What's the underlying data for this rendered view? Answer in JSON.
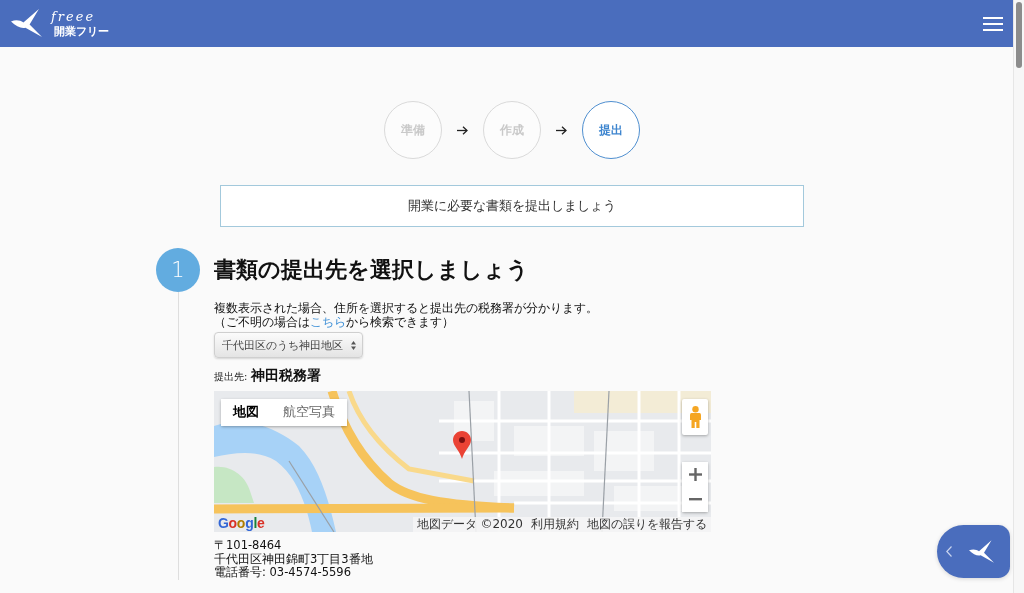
{
  "header": {
    "logo_script": "freee",
    "logo_title": "開業フリー"
  },
  "steps": [
    {
      "label": "準備",
      "selected": false
    },
    {
      "label": "作成",
      "selected": false
    },
    {
      "label": "提出",
      "selected": true
    }
  ],
  "banner": "開業に必要な書類を提出しましょう",
  "section": {
    "number": "1",
    "title": "書類の提出先を選択しましょう",
    "description": {
      "line_1": "複数表示された場合、住所を選択すると提出先の税務署が分かります。",
      "before_link": "（ご不明の場合は",
      "link": "こちら",
      "after_link": "から検索できます）"
    },
    "district_select": {
      "value": "千代田区のうち神田地区"
    },
    "office": {
      "label": "提出先:",
      "name": "神田税務署"
    },
    "map": {
      "map_types": [
        {
          "label": "地図",
          "selected": true
        },
        {
          "label": "航空写真",
          "selected": false
        }
      ],
      "logo": "Google",
      "data_credit": "地図データ ©2020",
      "terms_link": "利用規約",
      "report_link": "地図の誤りを報告する"
    },
    "address": {
      "postal_code": "〒101-8464",
      "street": "千代田区神田錦町3丁目3番地",
      "phone": "電話番号: 03-4574-5596"
    }
  }
}
